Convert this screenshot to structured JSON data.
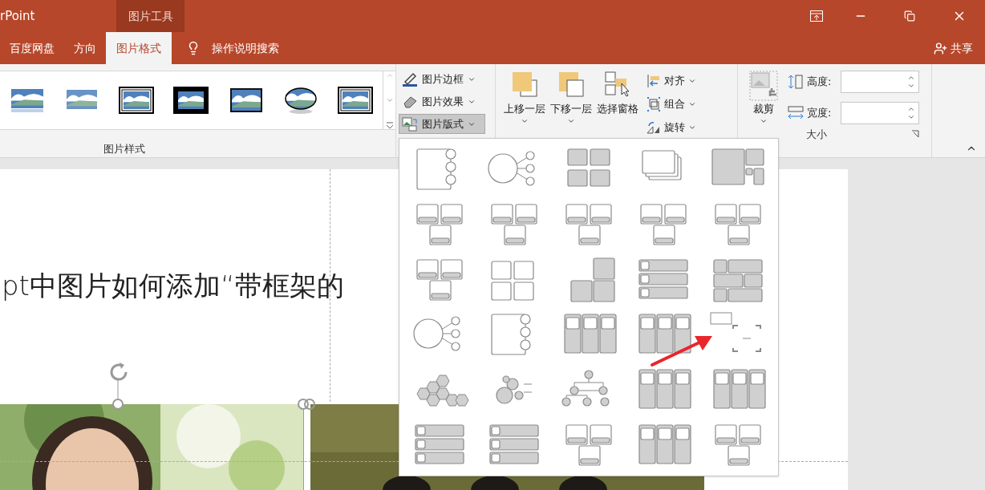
{
  "app_title": "rPoint",
  "context_tab": "图片工具",
  "tabs": [
    {
      "label": "百度网盘",
      "selected": false
    },
    {
      "label": "方向",
      "selected": false
    },
    {
      "label": "图片格式",
      "selected": true
    }
  ],
  "tell_me": "操作说明搜索",
  "share": "共享",
  "picture_styles": {
    "label": "图片样式",
    "items": [
      {
        "kind": "reflected"
      },
      {
        "kind": "soft"
      },
      {
        "kind": "double"
      },
      {
        "kind": "thick"
      },
      {
        "kind": "shadow"
      },
      {
        "kind": "oval"
      },
      {
        "kind": "double"
      }
    ]
  },
  "picture_buttons": [
    {
      "label": "图片边框",
      "kind": "border",
      "pressed": false
    },
    {
      "label": "图片效果",
      "kind": "effects",
      "pressed": false
    },
    {
      "label": "图片版式",
      "kind": "layout",
      "pressed": true
    }
  ],
  "arrange_large": [
    {
      "label": "上移一层",
      "kind": "forward",
      "dropdown": true
    },
    {
      "label": "下移一层",
      "kind": "backward",
      "dropdown": true
    },
    {
      "label": "选择窗格",
      "kind": "pane",
      "dropdown": false
    }
  ],
  "arrange_small": [
    {
      "label": "对齐",
      "kind": "align"
    },
    {
      "label": "组合",
      "kind": "group"
    },
    {
      "label": "旋转",
      "kind": "rotate"
    }
  ],
  "size": {
    "crop": "裁剪",
    "height_label": "高度:",
    "width_label": "宽度:",
    "label": "大小"
  },
  "slide": {
    "title": "pt中图片如何添加“带框架的"
  },
  "layouts": [
    {
      "kind": "circles"
    },
    {
      "kind": "branch"
    },
    {
      "kind": "grid"
    },
    {
      "kind": "stack"
    },
    {
      "kind": "mosaic"
    },
    {
      "kind": "frames"
    },
    {
      "kind": "frames"
    },
    {
      "kind": "frames"
    },
    {
      "kind": "frames"
    },
    {
      "kind": "frames"
    },
    {
      "kind": "frames"
    },
    {
      "kind": "outline"
    },
    {
      "kind": "blocks"
    },
    {
      "kind": "list"
    },
    {
      "kind": "bricks"
    },
    {
      "kind": "branch"
    },
    {
      "kind": "circles"
    },
    {
      "kind": "columns"
    },
    {
      "kind": "columns"
    },
    {
      "kind": "bracket"
    },
    {
      "kind": "hex"
    },
    {
      "kind": "bubbles"
    },
    {
      "kind": "tree"
    },
    {
      "kind": "columns"
    },
    {
      "kind": "columns"
    },
    {
      "kind": "list"
    },
    {
      "kind": "list"
    },
    {
      "kind": "frames"
    },
    {
      "kind": "columns"
    },
    {
      "kind": "frames"
    }
  ]
}
